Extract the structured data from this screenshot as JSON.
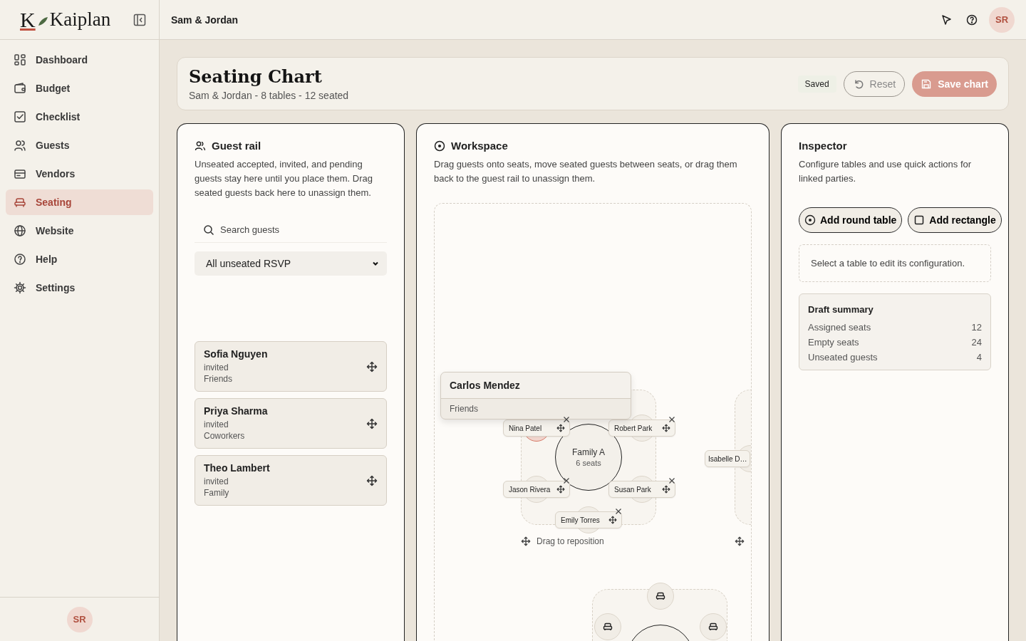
{
  "logo": {
    "mark": "K",
    "name": "Kaiplan"
  },
  "topbar": {
    "title": "Sam & Jordan",
    "avatar": "SR"
  },
  "sidebar": {
    "items": [
      {
        "label": "Dashboard",
        "selected": false
      },
      {
        "label": "Budget",
        "selected": false
      },
      {
        "label": "Checklist",
        "selected": false
      },
      {
        "label": "Guests",
        "selected": false
      },
      {
        "label": "Vendors",
        "selected": false
      },
      {
        "label": "Seating",
        "selected": true
      },
      {
        "label": "Website",
        "selected": false
      },
      {
        "label": "Help",
        "selected": false
      },
      {
        "label": "Settings",
        "selected": false
      }
    ],
    "avatar": "SR"
  },
  "header": {
    "title": "Seating Chart",
    "subtitle": "Sam & Jordan - 8 tables - 12 seated",
    "status": "Saved",
    "buttons": [
      {
        "label": "Reset",
        "kind": "secondary"
      },
      {
        "label": "Save chart",
        "kind": "primary"
      }
    ]
  },
  "guest_rail": {
    "title": "Guest rail",
    "description": "Unseated accepted, invited, and pending guests stay here until you place them. Drag seated guests back here to unassign them.",
    "search": {
      "placeholder": "Search guests"
    },
    "filter": {
      "value": "All unseated RSVP"
    },
    "guests": [
      {
        "name": "Sofia Nguyen",
        "status": "invited",
        "group": "Friends"
      },
      {
        "name": "Priya Sharma",
        "status": "invited",
        "group": "Coworkers"
      },
      {
        "name": "Theo Lambert",
        "status": "invited",
        "group": "Family"
      }
    ]
  },
  "workspace": {
    "title": "Workspace",
    "description": "Drag guests onto seats, move seated guests between seats, or drag them back to the guest rail to unassign them.",
    "tables": [
      {
        "name": "Family A",
        "seats_label": "6 seats",
        "hint": "Drag to reposition",
        "seats": [
          {
            "occupied": true,
            "guest": "Nina Patel",
            "highlighted": true
          },
          {
            "occupied": true,
            "guest": "Robert Park",
            "highlighted": false
          },
          {
            "occupied": true,
            "guest": "Jason Rivera",
            "highlighted": false
          },
          {
            "occupied": true,
            "guest": "Susan Park",
            "highlighted": false
          },
          {
            "occupied": true,
            "guest": "Emily Torres",
            "highlighted": false
          }
        ]
      },
      {
        "seats": [
          {
            "occupied": true,
            "guest": "Isabelle D…",
            "highlighted": false
          }
        ]
      },
      {
        "seats": [
          {
            "occupied": false,
            "highlighted": false
          },
          {
            "occupied": false,
            "highlighted": false
          },
          {
            "occupied": false,
            "highlighted": false
          }
        ]
      }
    ],
    "drag_preview": {
      "name": "Carlos Mendez",
      "group": "Friends"
    }
  },
  "inspector": {
    "title": "Inspector",
    "description": "Configure tables and use quick actions for linked parties.",
    "buttons": [
      {
        "label": "Add round table",
        "kind": "round"
      },
      {
        "label": "Add rectangle",
        "kind": "rectangle"
      }
    ],
    "empty_note": "Select a table to edit its configuration.",
    "summary": {
      "title": "Draft summary",
      "rows": [
        {
          "label": "Assigned seats",
          "value": "12"
        },
        {
          "label": "Empty seats",
          "value": "24"
        },
        {
          "label": "Unseated guests",
          "value": "4"
        }
      ]
    }
  }
}
